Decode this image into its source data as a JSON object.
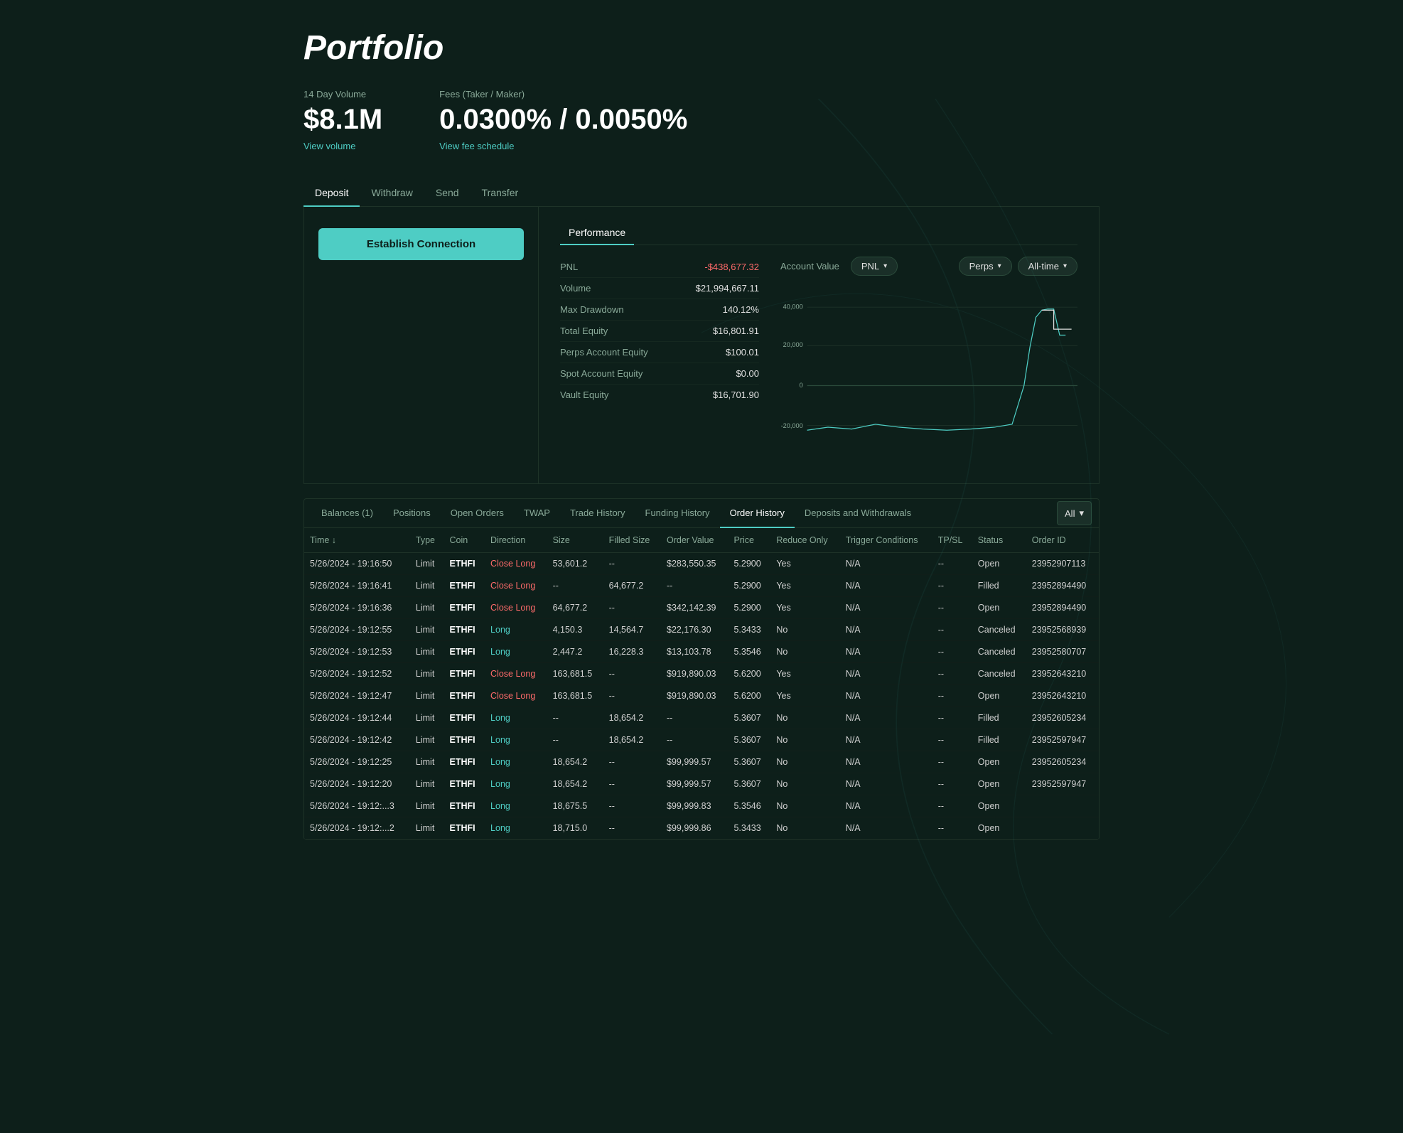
{
  "page": {
    "title": "Portfolio"
  },
  "stats": {
    "volume_label": "14 Day Volume",
    "volume_value": "$8.1M",
    "volume_link": "View volume",
    "fees_label": "Fees (Taker / Maker)",
    "fees_value": "0.0300% / 0.0050%",
    "fees_link": "View fee schedule"
  },
  "top_tabs": [
    {
      "label": "Deposit",
      "active": true
    },
    {
      "label": "Withdraw",
      "active": false
    },
    {
      "label": "Send",
      "active": false
    },
    {
      "label": "Transfer",
      "active": false
    }
  ],
  "establish_btn": "Establish Connection",
  "performance_tab": "Performance",
  "perf_stats": [
    {
      "label": "PNL",
      "value": "-$438,677.32",
      "negative": true
    },
    {
      "label": "Volume",
      "value": "$21,994,667.11",
      "negative": false
    },
    {
      "label": "Max Drawdown",
      "value": "140.12%",
      "negative": false
    },
    {
      "label": "Total Equity",
      "value": "$16,801.91",
      "negative": false
    },
    {
      "label": "Perps Account Equity",
      "value": "$100.01",
      "negative": false
    },
    {
      "label": "Spot Account Equity",
      "value": "$0.00",
      "negative": false
    },
    {
      "label": "Vault Equity",
      "value": "$16,701.90",
      "negative": false
    }
  ],
  "chart_controls": {
    "account_value_label": "Account Value",
    "pnl_btn": "PNL",
    "perps_btn": "Perps",
    "alltime_btn": "All-time"
  },
  "chart": {
    "y_labels": [
      "40,000",
      "20,000",
      "0",
      "-20,000"
    ],
    "y_values": [
      40000,
      20000,
      0,
      -20000
    ]
  },
  "bottom_tabs": [
    {
      "label": "Balances (1)",
      "active": false
    },
    {
      "label": "Positions",
      "active": false
    },
    {
      "label": "Open Orders",
      "active": false
    },
    {
      "label": "TWAP",
      "active": false
    },
    {
      "label": "Trade History",
      "active": false
    },
    {
      "label": "Funding History",
      "active": false
    },
    {
      "label": "Order History",
      "active": true
    },
    {
      "label": "Deposits and Withdrawals",
      "active": false
    }
  ],
  "filter_btn": "All",
  "table_headers": [
    {
      "label": "Time",
      "sortable": true
    },
    {
      "label": "Type"
    },
    {
      "label": "Coin"
    },
    {
      "label": "Direction"
    },
    {
      "label": "Size"
    },
    {
      "label": "Filled Size"
    },
    {
      "label": "Order Value"
    },
    {
      "label": "Price"
    },
    {
      "label": "Reduce Only"
    },
    {
      "label": "Trigger Conditions"
    },
    {
      "label": "TP/SL"
    },
    {
      "label": "Status"
    },
    {
      "label": "Order ID"
    }
  ],
  "table_rows": [
    {
      "time": "5/26/2024 - 19:16:50",
      "type": "Limit",
      "coin": "ETHFI",
      "direction": "Close Long",
      "size": "53,601.2",
      "filled_size": "--",
      "order_value": "$283,550.35",
      "price": "5.2900",
      "reduce_only": "Yes",
      "trigger": "N/A",
      "tpsl": "--",
      "status": "Open",
      "order_id": "23952907113"
    },
    {
      "time": "5/26/2024 - 19:16:41",
      "type": "Limit",
      "coin": "ETHFI",
      "direction": "Close Long",
      "size": "--",
      "filled_size": "64,677.2",
      "order_value": "--",
      "price": "5.2900",
      "reduce_only": "Yes",
      "trigger": "N/A",
      "tpsl": "--",
      "status": "Filled",
      "order_id": "23952894490"
    },
    {
      "time": "5/26/2024 - 19:16:36",
      "type": "Limit",
      "coin": "ETHFI",
      "direction": "Close Long",
      "size": "64,677.2",
      "filled_size": "--",
      "order_value": "$342,142.39",
      "price": "5.2900",
      "reduce_only": "Yes",
      "trigger": "N/A",
      "tpsl": "--",
      "status": "Open",
      "order_id": "23952894490"
    },
    {
      "time": "5/26/2024 - 19:12:55",
      "type": "Limit",
      "coin": "ETHFI",
      "direction": "Long",
      "size": "4,150.3",
      "filled_size": "14,564.7",
      "order_value": "$22,176.30",
      "price": "5.3433",
      "reduce_only": "No",
      "trigger": "N/A",
      "tpsl": "--",
      "status": "Canceled",
      "order_id": "23952568939"
    },
    {
      "time": "5/26/2024 - 19:12:53",
      "type": "Limit",
      "coin": "ETHFI",
      "direction": "Long",
      "size": "2,447.2",
      "filled_size": "16,228.3",
      "order_value": "$13,103.78",
      "price": "5.3546",
      "reduce_only": "No",
      "trigger": "N/A",
      "tpsl": "--",
      "status": "Canceled",
      "order_id": "23952580707"
    },
    {
      "time": "5/26/2024 - 19:12:52",
      "type": "Limit",
      "coin": "ETHFI",
      "direction": "Close Long",
      "size": "163,681.5",
      "filled_size": "--",
      "order_value": "$919,890.03",
      "price": "5.6200",
      "reduce_only": "Yes",
      "trigger": "N/A",
      "tpsl": "--",
      "status": "Canceled",
      "order_id": "23952643210"
    },
    {
      "time": "5/26/2024 - 19:12:47",
      "type": "Limit",
      "coin": "ETHFI",
      "direction": "Close Long",
      "size": "163,681.5",
      "filled_size": "--",
      "order_value": "$919,890.03",
      "price": "5.6200",
      "reduce_only": "Yes",
      "trigger": "N/A",
      "tpsl": "--",
      "status": "Open",
      "order_id": "23952643210"
    },
    {
      "time": "5/26/2024 - 19:12:44",
      "type": "Limit",
      "coin": "ETHFI",
      "direction": "Long",
      "size": "--",
      "filled_size": "18,654.2",
      "order_value": "--",
      "price": "5.3607",
      "reduce_only": "No",
      "trigger": "N/A",
      "tpsl": "--",
      "status": "Filled",
      "order_id": "23952605234"
    },
    {
      "time": "5/26/2024 - 19:12:42",
      "type": "Limit",
      "coin": "ETHFI",
      "direction": "Long",
      "size": "--",
      "filled_size": "18,654.2",
      "order_value": "--",
      "price": "5.3607",
      "reduce_only": "No",
      "trigger": "N/A",
      "tpsl": "--",
      "status": "Filled",
      "order_id": "23952597947"
    },
    {
      "time": "5/26/2024 - 19:12:25",
      "type": "Limit",
      "coin": "ETHFI",
      "direction": "Long",
      "size": "18,654.2",
      "filled_size": "--",
      "order_value": "$99,999.57",
      "price": "5.3607",
      "reduce_only": "No",
      "trigger": "N/A",
      "tpsl": "--",
      "status": "Open",
      "order_id": "23952605234"
    },
    {
      "time": "5/26/2024 - 19:12:20",
      "type": "Limit",
      "coin": "ETHFI",
      "direction": "Long",
      "size": "18,654.2",
      "filled_size": "--",
      "order_value": "$99,999.57",
      "price": "5.3607",
      "reduce_only": "No",
      "trigger": "N/A",
      "tpsl": "--",
      "status": "Open",
      "order_id": "23952597947"
    },
    {
      "time": "5/26/2024 - 19:12:...3",
      "type": "Limit",
      "coin": "ETHFI",
      "direction": "Long",
      "size": "18,675.5",
      "filled_size": "--",
      "order_value": "$99,999.83",
      "price": "5.3546",
      "reduce_only": "No",
      "trigger": "N/A",
      "tpsl": "--",
      "status": "Open",
      "order_id": ""
    },
    {
      "time": "5/26/2024 - 19:12:...2",
      "type": "Limit",
      "coin": "ETHFI",
      "direction": "Long",
      "size": "18,715.0",
      "filled_size": "--",
      "order_value": "$99,999.86",
      "price": "5.3433",
      "reduce_only": "No",
      "trigger": "N/A",
      "tpsl": "--",
      "status": "Open",
      "order_id": ""
    }
  ]
}
